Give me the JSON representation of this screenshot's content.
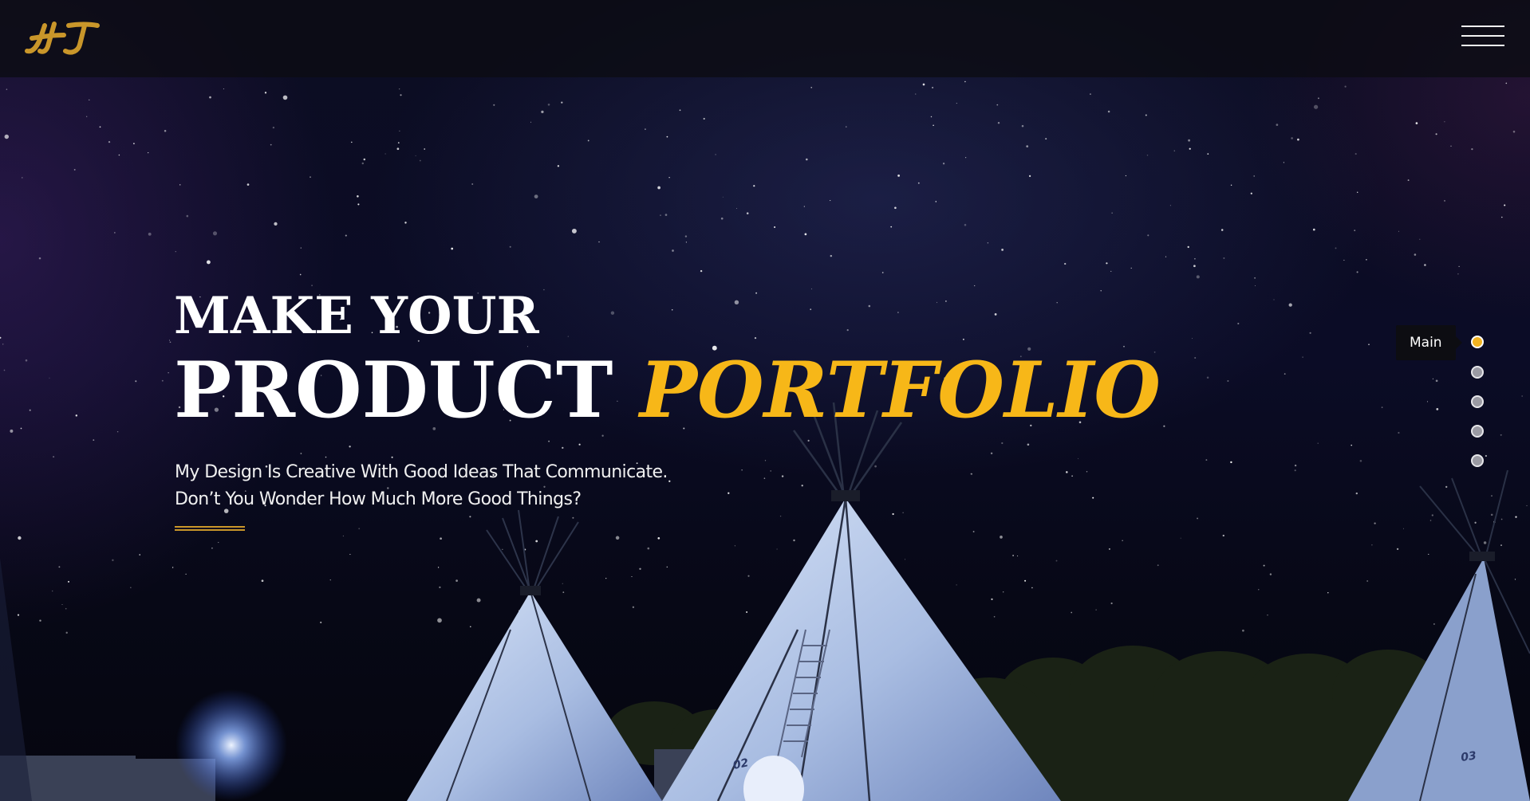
{
  "brand": {
    "logo_text": "HJ"
  },
  "menu": {
    "icon": "hamburger-menu-icon"
  },
  "hero": {
    "headline_line1": "MAKE YOUR",
    "headline_word": "PRODUCT",
    "headline_accent": "PORTFOLIO",
    "subtitle_line1": "My Design Is Creative With Good Ideas That Communicate.",
    "subtitle_line2": "Don’t You Wonder How Much More Good Things?",
    "tent_labels": [
      "02",
      "03"
    ]
  },
  "side_nav": {
    "tooltip": "Main",
    "dots": 5,
    "active_index": 0
  },
  "colors": {
    "accent": "#f7b718",
    "logo": "#c9962a",
    "text": "#ffffff",
    "topbar": "#0c0c14",
    "sky": "#0b0c26"
  }
}
